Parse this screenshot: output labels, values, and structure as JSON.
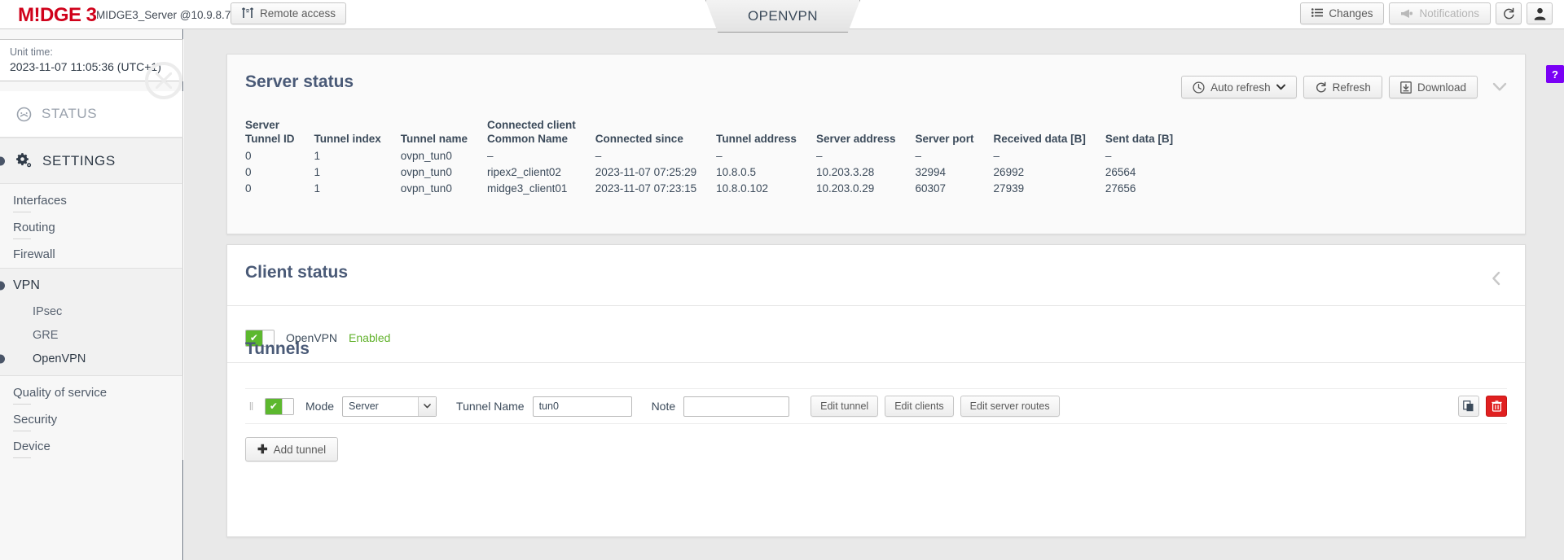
{
  "topbar": {
    "logo": "M!DGE 3",
    "unit_name": "MIDGE3_Server @10.9.8.7",
    "remote_access_label": "Remote access",
    "remote_access_icon": "antenna-icon",
    "changes_label": "Changes",
    "changes_icon": "list-icon",
    "notifications_label": "Notifications",
    "notifications_icon": "megaphone-icon",
    "refresh_icon": "refresh-icon",
    "user_icon": "user-icon"
  },
  "page_tab": {
    "label": "OPENVPN"
  },
  "help_badge": {
    "label": "?"
  },
  "sidebar": {
    "unit_time_label": "Unit time:",
    "unit_time_value": "2023-11-07 11:05:36 (UTC+1)",
    "status_label": "STATUS",
    "status_icon": "gauge-icon",
    "settings_label": "SETTINGS",
    "settings_icon": "gear-icon",
    "items": [
      {
        "label": "Interfaces"
      },
      {
        "label": "Routing"
      },
      {
        "label": "Firewall"
      }
    ],
    "vpn": {
      "label": "VPN",
      "sub": [
        {
          "label": "IPsec",
          "active": false
        },
        {
          "label": "GRE",
          "active": false
        },
        {
          "label": "OpenVPN",
          "active": true
        }
      ]
    },
    "items_after": [
      {
        "label": "Quality of service"
      },
      {
        "label": "Security"
      },
      {
        "label": "Device"
      }
    ]
  },
  "server_status": {
    "title": "Server status",
    "toolbar": {
      "auto_refresh_label": "Auto refresh",
      "auto_refresh_icon": "clock-icon",
      "refresh_label": "Refresh",
      "refresh_icon": "refresh-icon",
      "download_label": "Download",
      "download_icon": "download-icon",
      "collapse_icon": "chevron-down-icon"
    },
    "columns": [
      {
        "top": "Server",
        "bottom": "Tunnel ID"
      },
      {
        "top": "",
        "bottom": "Tunnel index"
      },
      {
        "top": "",
        "bottom": "Tunnel name"
      },
      {
        "top": "Connected client",
        "bottom": "Common Name"
      },
      {
        "top": "",
        "bottom": "Connected since"
      },
      {
        "top": "",
        "bottom": "Tunnel address"
      },
      {
        "top": "",
        "bottom": "Server address"
      },
      {
        "top": "",
        "bottom": "Server port"
      },
      {
        "top": "",
        "bottom": "Received data [B]"
      },
      {
        "top": "",
        "bottom": "Sent data [B]"
      }
    ],
    "rows": [
      [
        "0",
        "1",
        "ovpn_tun0",
        "–",
        "–",
        "–",
        "–",
        "–",
        "–",
        "–"
      ],
      [
        "0",
        "1",
        "ovpn_tun0",
        "ripex2_client02",
        "2023-11-07 07:25:29",
        "10.8.0.5",
        "10.203.3.28",
        "32994",
        "26992",
        "26564"
      ],
      [
        "0",
        "1",
        "ovpn_tun0",
        "midge3_client01",
        "2023-11-07 07:23:15",
        "10.8.0.102",
        "10.203.0.29",
        "60307",
        "27939",
        "27656"
      ]
    ]
  },
  "client_status": {
    "title": "Client status",
    "collapse_icon": "chevron-left-icon",
    "openvpn_toggle": {
      "label": "OpenVPN",
      "state_label": "Enabled",
      "checked": true
    }
  },
  "tunnels": {
    "title": "Tunnels",
    "row": {
      "drag_handle": "‖",
      "enabled": true,
      "mode_label": "Mode",
      "mode_value": "Server",
      "tunnel_name_label": "Tunnel Name",
      "tunnel_name_value": "tun0",
      "note_label": "Note",
      "note_value": "",
      "edit_tunnel_label": "Edit tunnel",
      "edit_clients_label": "Edit clients",
      "edit_server_routes_label": "Edit server routes",
      "duplicate_icon": "copy-icon",
      "delete_icon": "trash-icon"
    },
    "add_label": "Add tunnel",
    "add_icon": "plus-icon"
  },
  "colors": {
    "brand_red": "#d0021b",
    "accent_green": "#5cb82e",
    "enabled_green": "#62b22c",
    "danger_red": "#e02020",
    "help_purple": "#7a00f5",
    "title_blue": "#4a5a77"
  }
}
